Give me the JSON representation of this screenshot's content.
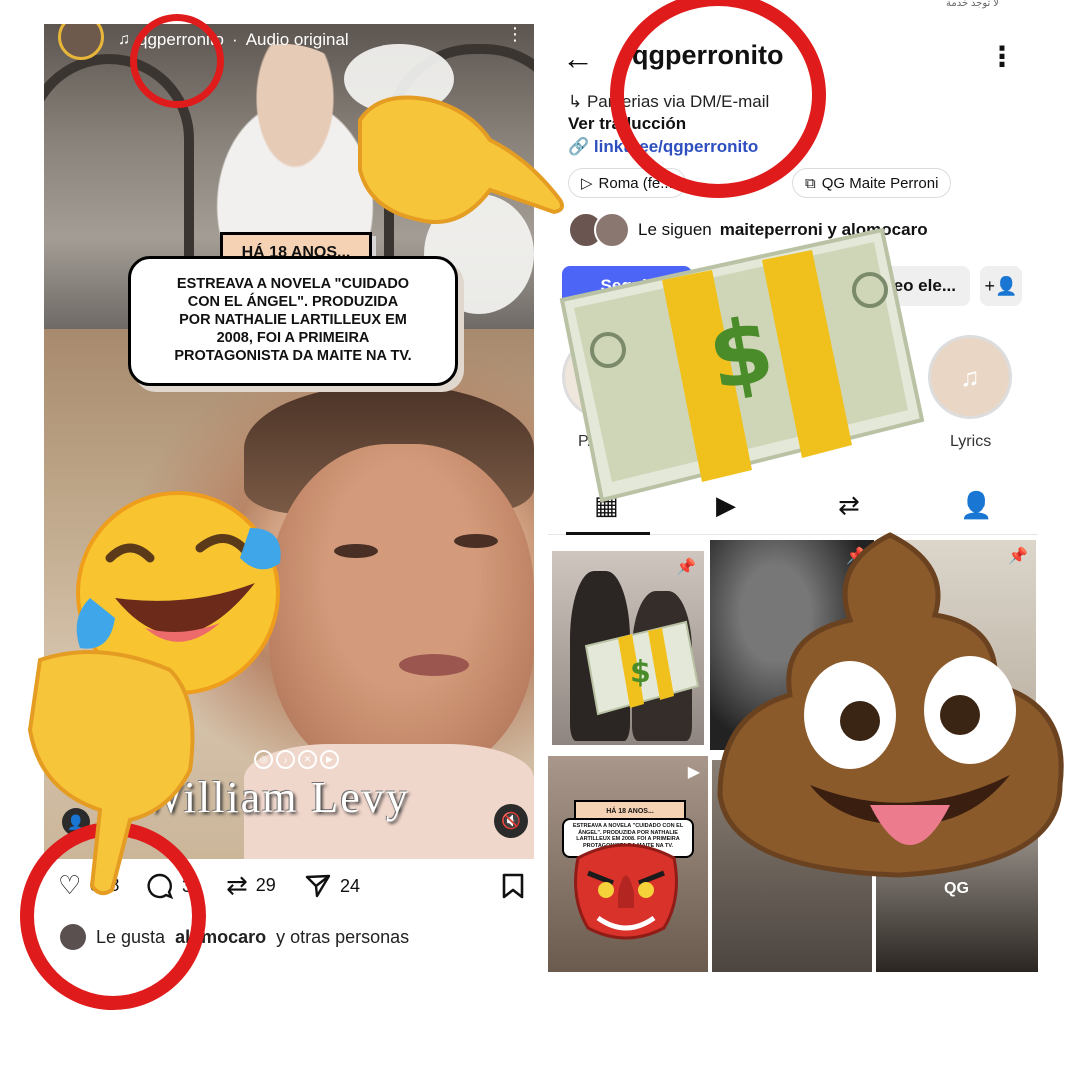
{
  "reel": {
    "author": "qgperronito",
    "audio": "Audio original",
    "badge": "HÁ 18 ANOS...",
    "caption": "ESTREAVA A NOVELA \"CUIDADO\nCON EL ÁNGEL\". PRODUZIDA\nPOR NATHALIE LARTILLEUX EM\n2008, FOI A PRIMEIRA\nPROTAGONISTA DA MAITE NA TV.",
    "actor_name": "William Levy",
    "likes_count": "678",
    "comments_count": "3",
    "reposts_count": "29",
    "shares_count": "24",
    "liked_by_prefix": "Le gusta",
    "liked_by_user": "alomocaro",
    "liked_by_suffix": "y otras personas"
  },
  "profile": {
    "username": "qgperronito",
    "bio": "Parcerias via DM/E-mail",
    "translate": "Ver traducción",
    "link": "linktr.ee/qgperronito",
    "chips": [
      "Roma (fe...",
      "QG Maite Perroni"
    ],
    "followed_by_prefix": "Le siguen",
    "followed_by": "maiteperroni y alomocaro",
    "follow_label": "Seguir",
    "message_label": "...eo ele...",
    "highlights": [
      {
        "label": "P..."
      },
      {
        "label": "Lyrics"
      }
    ],
    "grid_thumb_badge": "HÁ 18 ANOS...",
    "grid_thumb_caption": "ESTREAVA A NOVELA \"CUIDADO CON EL ÁNGEL\". PRODUZIDA POR NATHALIE LARTILLEUX EM 2008. FOI A PRIMEIRA PROTAGONISTA DA MAITE NA TV.",
    "grid_watermark": "QG"
  },
  "status_bar": {
    "carrier": "لا توجد خدمة"
  },
  "icons": {
    "music": "music-note-icon",
    "more": "more-dots-icon",
    "like": "heart-icon",
    "comment": "comment-icon",
    "repost": "repost-icon",
    "share": "send-icon",
    "save": "bookmark-icon",
    "mute": "mute-icon",
    "back": "back-arrow-icon",
    "pin": "pin-icon"
  },
  "colors": {
    "follow_blue": "#4c65f7",
    "link_blue": "#2d4fbf",
    "annotation_red": "#e01b1b"
  }
}
